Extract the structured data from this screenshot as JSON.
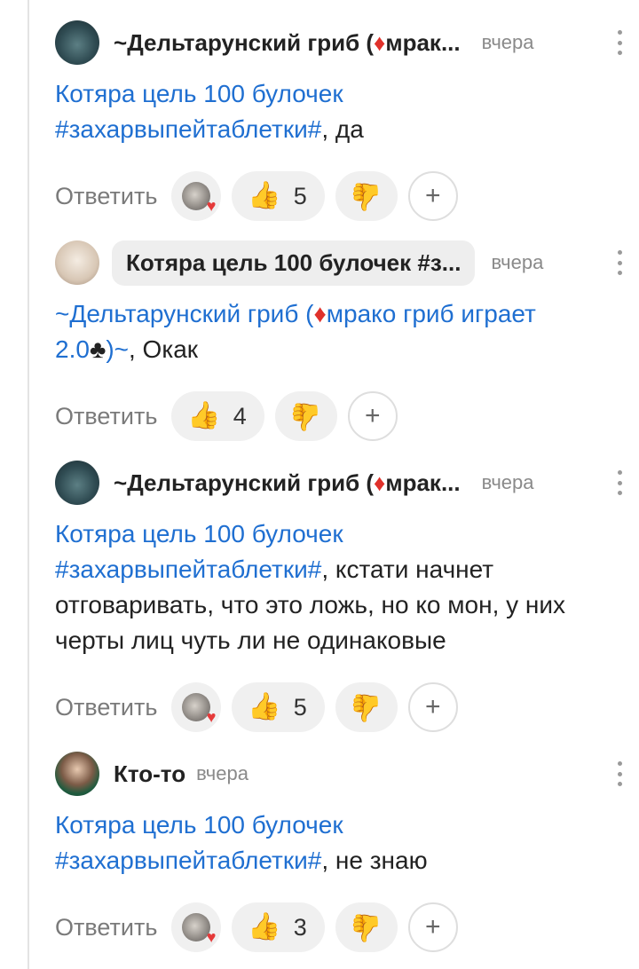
{
  "ui": {
    "reply_label": "Ответить",
    "add_reaction": "+",
    "like_icon": "thumbs-up-icon",
    "dislike_icon": "thumbs-down-icon",
    "accent_color": "#1f6fd1",
    "heart_color": "#e53a3a"
  },
  "comments": [
    {
      "author": "~Дельтарунский гриб (♦мрак...",
      "time": "вчера",
      "mention": "Котяра цель 100 булочек #захарвыпейтаблетки#",
      "text": ", да",
      "likes": "5"
    },
    {
      "author": "Котяра цель 100 булочек #з...",
      "time": "вчера",
      "mention": "~Дельтарунский гриб (♦мрако гриб играет 2.0♣)~",
      "text": ", Окак",
      "likes": "4"
    },
    {
      "author": "~Дельтарунский гриб (♦мрак...",
      "time": "вчера",
      "mention": "Котяра цель 100 булочек #захарвыпейтаблетки#",
      "text": ", кстати начнет отговаривать, что это ложь, но ко мон, у них черты лиц чуть ли не одинаковые",
      "likes": "5"
    },
    {
      "author": "Кто-то",
      "time": "вчера",
      "mention": "Котяра цель 100 булочек #захарвыпейтаблетки#",
      "text": ", не знаю",
      "likes": "3"
    }
  ]
}
